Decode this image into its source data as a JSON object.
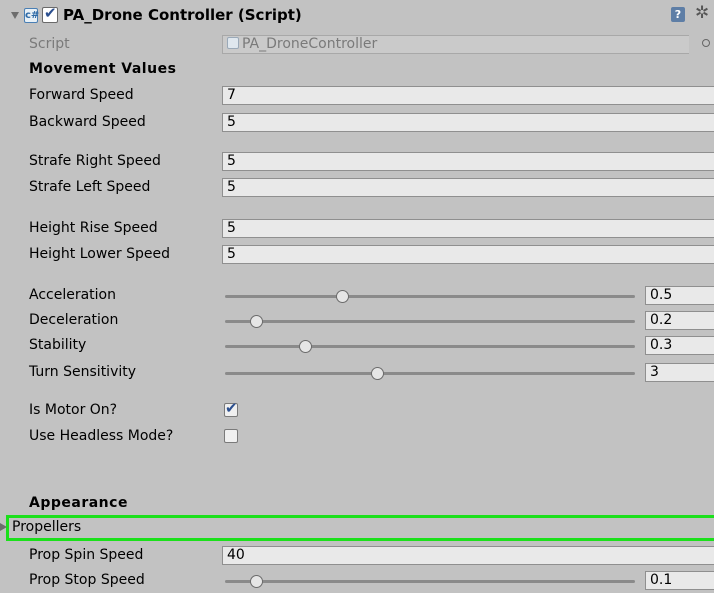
{
  "component": {
    "title": "PA_Drone Controller (Script)",
    "enabled": true,
    "badge_glyph": "c#",
    "help_glyph": "?",
    "gear_glyph": "✲"
  },
  "script_row": {
    "label": "Script",
    "value": "PA_DroneController"
  },
  "sections": {
    "movement": "Movement Values",
    "appearance": "Appearance"
  },
  "fields": {
    "forward_speed": {
      "label": "Forward Speed",
      "value": "7"
    },
    "backward_speed": {
      "label": "Backward Speed",
      "value": "5"
    },
    "strafe_right_speed": {
      "label": "Strafe Right Speed",
      "value": "5"
    },
    "strafe_left_speed": {
      "label": "Strafe Left Speed",
      "value": "5"
    },
    "height_rise_speed": {
      "label": "Height Rise Speed",
      "value": "5"
    },
    "height_lower_speed": {
      "label": "Height Lower Speed",
      "value": "5"
    }
  },
  "sliders": {
    "acceleration": {
      "label": "Acceleration",
      "value": "0.5",
      "fraction": 0.285
    },
    "deceleration": {
      "label": "Deceleration",
      "value": "0.2",
      "fraction": 0.075
    },
    "stability": {
      "label": "Stability",
      "value": "0.3",
      "fraction": 0.195
    },
    "turn_sensitivity": {
      "label": "Turn Sensitivity",
      "value": "3",
      "fraction": 0.37
    }
  },
  "toggles": {
    "is_motor_on": {
      "label": "Is Motor On?",
      "checked": true
    },
    "use_headless_mode": {
      "label": "Use Headless Mode?",
      "checked": false
    }
  },
  "appearance": {
    "propellers": {
      "label": "Propellers",
      "expanded": false
    },
    "prop_spin_speed": {
      "label": "Prop Spin Speed",
      "value": "40"
    },
    "prop_stop_speed": {
      "label": "Prop Stop Speed",
      "value": "0.1",
      "fraction": 0.075
    }
  },
  "colors": {
    "background": "#c2c2c2",
    "highlight": "#1be01b",
    "checkmark": "#2b4f8f"
  }
}
